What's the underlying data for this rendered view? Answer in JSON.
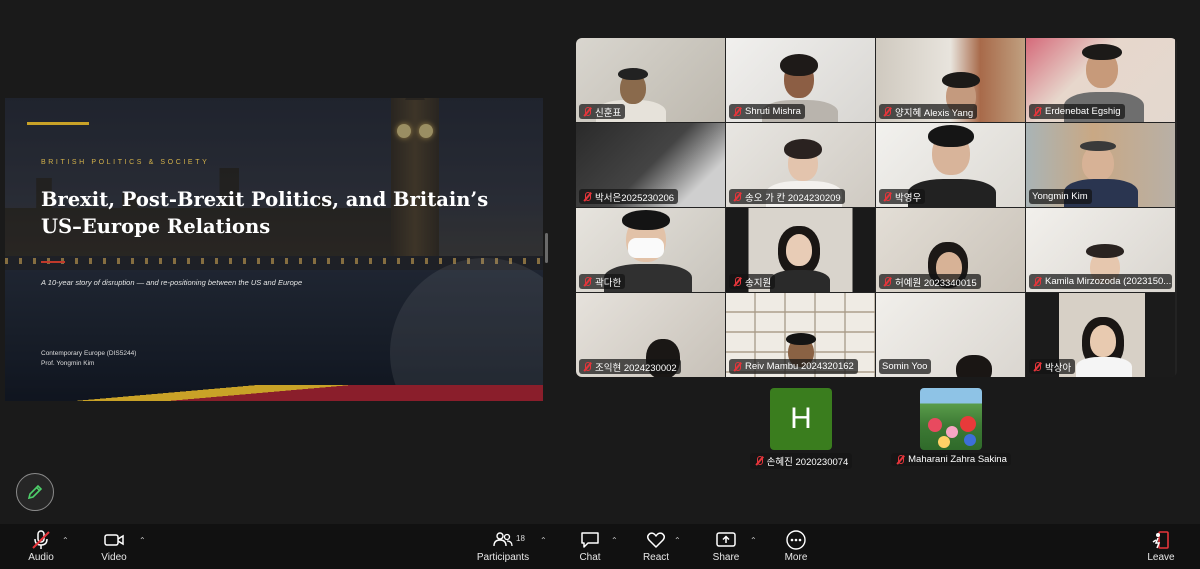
{
  "slide": {
    "kicker": "BRITISH POLITICS & SOCIETY",
    "title": "Brexit, Post-Brexit Politics, and Britain’s US–Europe Relations",
    "subtitle": "A 10-year story of disruption — and re-positioning between the US and Europe",
    "course": "Contemporary Europe (DIS5244)",
    "professor": "Prof. Yongmin Kim"
  },
  "participants": [
    {
      "name": "신훈표",
      "muted": true
    },
    {
      "name": "Shruti Mishra",
      "muted": true
    },
    {
      "name": "양지혜 Alexis Yang",
      "muted": true
    },
    {
      "name": "Erdenebat Egshig",
      "muted": true
    },
    {
      "name": "박서은2025230206",
      "muted": true
    },
    {
      "name": "송오 가 칸 2024230209",
      "muted": true
    },
    {
      "name": "박영우",
      "muted": true
    },
    {
      "name": "Yongmin Kim",
      "muted": false,
      "active": true
    },
    {
      "name": "곽다한",
      "muted": true
    },
    {
      "name": "송지원",
      "muted": true
    },
    {
      "name": "허예원 2023340015",
      "muted": true
    },
    {
      "name": "Kamila Mirzozoda (2023150...",
      "muted": true
    },
    {
      "name": "조익현 2024230002",
      "muted": true
    },
    {
      "name": "Reiv Mambu 2024320162",
      "muted": true
    },
    {
      "name": "Somin Yoo",
      "muted": false
    },
    {
      "name": "박상아",
      "muted": true
    }
  ],
  "avatars": [
    {
      "name": "손혜진 2020230074",
      "letter": "H",
      "color": "#3a7d1e"
    },
    {
      "name": "Maharani Zahra Sakina"
    }
  ],
  "toolbar": {
    "audio": "Audio",
    "video": "Video",
    "participants": "Participants",
    "participants_count": "18",
    "chat": "Chat",
    "react": "React",
    "share": "Share",
    "more": "More",
    "leave": "Leave"
  }
}
